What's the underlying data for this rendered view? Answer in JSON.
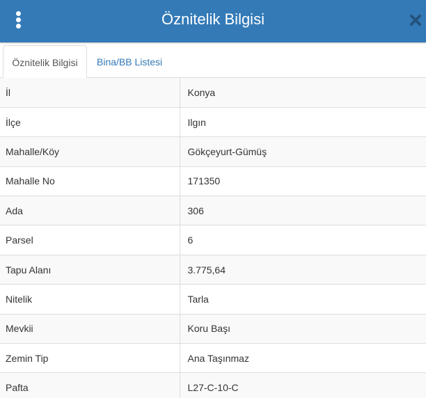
{
  "header": {
    "title": "Öznitelik Bilgisi",
    "menu_icon": "vertical-ellipsis-icon",
    "close_icon": "close-icon"
  },
  "tabs": [
    {
      "label": "Öznitelik Bilgisi",
      "active": true
    },
    {
      "label": "Bina/BB Listesi",
      "active": false
    }
  ],
  "rows": [
    {
      "key": "İl",
      "value": "Konya"
    },
    {
      "key": "İlçe",
      "value": "Ilgın"
    },
    {
      "key": "Mahalle/Köy",
      "value": "Gökçeyurt-Gümüş"
    },
    {
      "key": "Mahalle No",
      "value": "171350"
    },
    {
      "key": "Ada",
      "value": "306"
    },
    {
      "key": "Parsel",
      "value": "6"
    },
    {
      "key": "Tapu Alanı",
      "value": "3.775,64"
    },
    {
      "key": "Nitelik",
      "value": "Tarla"
    },
    {
      "key": "Mevkii",
      "value": "Koru Başı"
    },
    {
      "key": "Zemin Tip",
      "value": "Ana Taşınmaz"
    },
    {
      "key": "Pafta",
      "value": "L27-C-10-C"
    }
  ],
  "colors": {
    "header_bg": "#337ab7",
    "header_text": "#ffffff",
    "close_icon": "#23527c",
    "tab_link": "#337ab7",
    "stripe": "#f9f9f9",
    "border": "#dddddd"
  }
}
